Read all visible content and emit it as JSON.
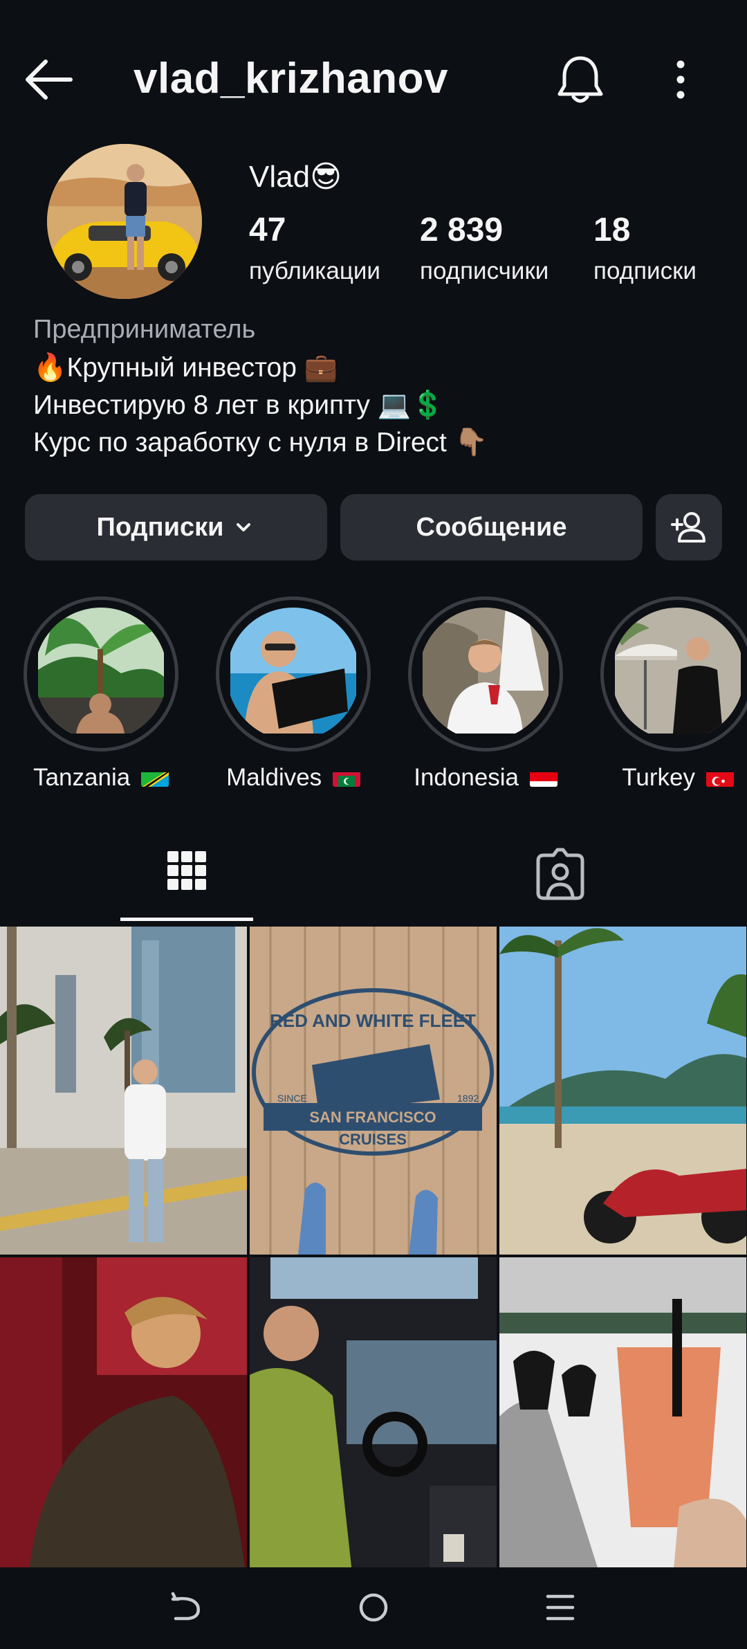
{
  "header": {
    "username": "vlad_krizhanov",
    "back_icon": "arrow-left-icon",
    "bell_icon": "bell-icon",
    "more_icon": "more-vertical-icon"
  },
  "profile": {
    "display_name": "Vlad😎",
    "stats": [
      {
        "value": "47",
        "label": "публикации"
      },
      {
        "value": "2 839",
        "label": "подписчики"
      },
      {
        "value": "18",
        "label": "подписки"
      }
    ],
    "category": "Предприниматель",
    "bio": [
      "🔥Крупный инвестор 💼",
      "Инвестирую 8 лет в крипту 💻💲",
      "Курс по заработку с нуля в Direct 👇🏽"
    ]
  },
  "actions": {
    "following_label": "Подписки",
    "message_label": "Сообщение",
    "add_user_icon": "add-user-icon"
  },
  "highlights": [
    {
      "label": "Tanzania"
    },
    {
      "label": "Maldives"
    },
    {
      "label": "Indonesia"
    },
    {
      "label": "Turkey"
    }
  ],
  "tabs": {
    "grid_icon": "grid-icon",
    "tagged_icon": "tagged-person-icon"
  },
  "posts": {
    "post2_text": [
      "RED AND WHITE FLEET",
      "SINCE",
      "1892",
      "SAN FRANCISCO",
      "CRUISES"
    ]
  },
  "colors": {
    "background": "#0c0f14",
    "button": "#2a2d33",
    "muted_text": "#a9adb5"
  }
}
